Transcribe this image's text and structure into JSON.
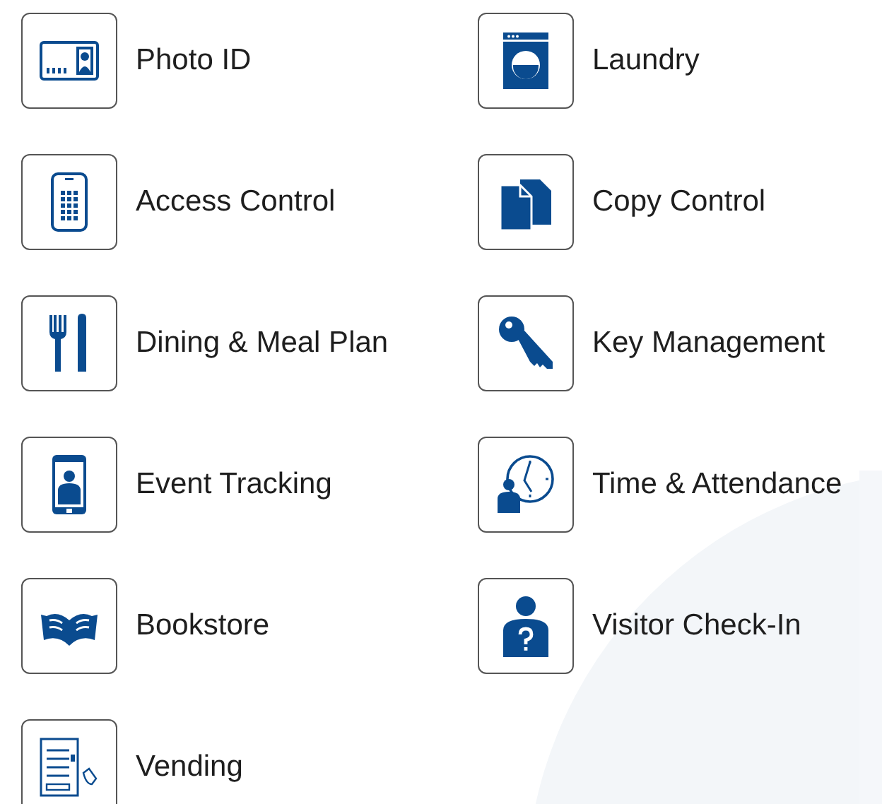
{
  "services": [
    {
      "label": "Photo ID"
    },
    {
      "label": "Laundry"
    },
    {
      "label": "Access Control"
    },
    {
      "label": "Copy Control"
    },
    {
      "label": "Dining & Meal Plan"
    },
    {
      "label": "Key Management"
    },
    {
      "label": "Event Tracking"
    },
    {
      "label": "Time & Attendance"
    },
    {
      "label": "Bookstore"
    },
    {
      "label": "Visitor Check-In"
    },
    {
      "label": "Vending"
    }
  ]
}
